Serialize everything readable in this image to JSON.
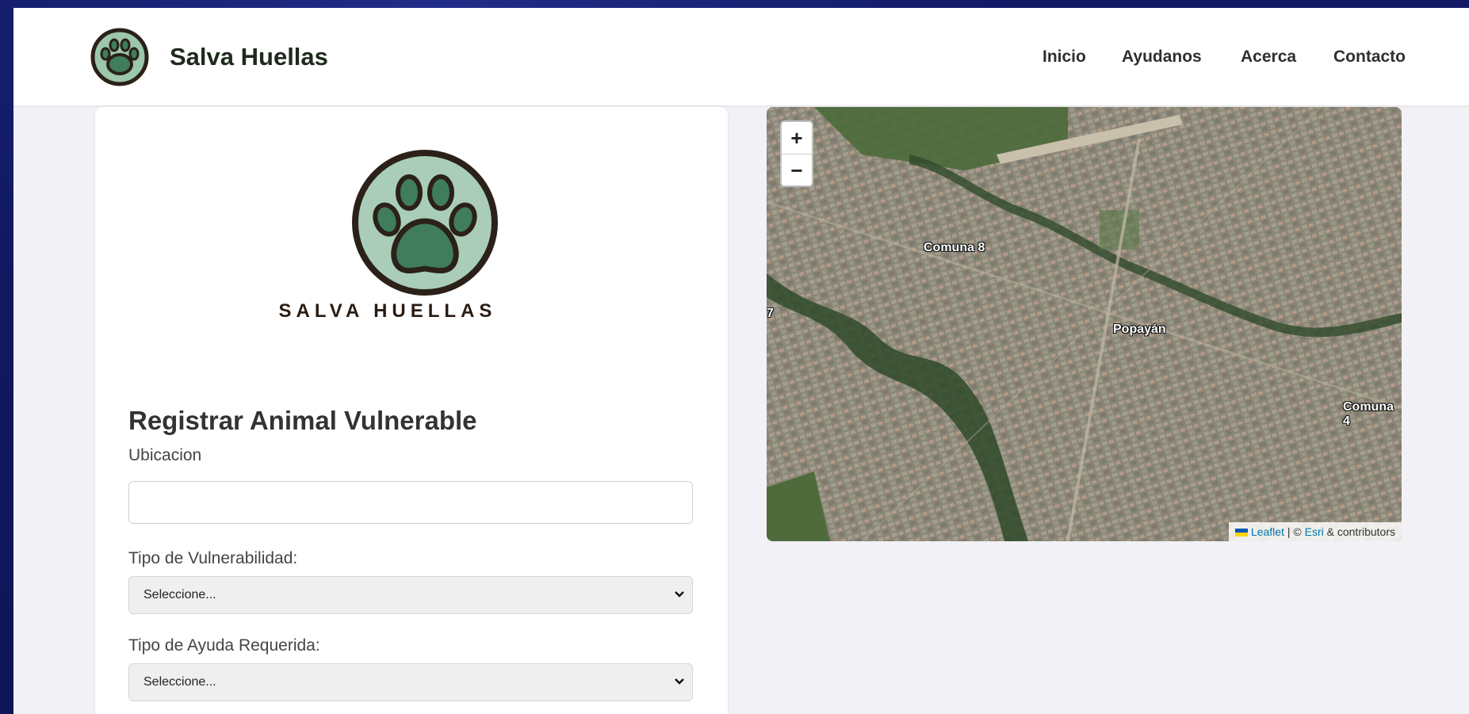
{
  "navbar": {
    "brand": "Salva Huellas",
    "links": [
      "Inicio",
      "Ayudanos",
      "Acerca",
      "Contacto"
    ]
  },
  "form": {
    "logo_text": "SALVA HUELLAS",
    "title": "Registrar Animal Vulnerable",
    "ubicacion_label": "Ubicacion",
    "ubicacion_value": "",
    "vulnerabilidad_label": "Tipo de Vulnerabilidad:",
    "vulnerabilidad_selected": "Seleccione...",
    "ayuda_label": "Tipo de Ayuda Requerida:",
    "ayuda_selected": "Seleccione..."
  },
  "map": {
    "labels": [
      "Comuna 8",
      "Popayán",
      "Comuna 4",
      "7"
    ],
    "zoom_in": "+",
    "zoom_out": "−",
    "attribution": {
      "leaflet": "Leaflet",
      "sep": " | © ",
      "esri": "Esri",
      "rest": " & contributors"
    }
  },
  "colors": {
    "brand_green": "#4b8a6a",
    "paw_dark": "#2b2118",
    "page_bg": "#f2f2f6",
    "outer_bg": "#10185e"
  }
}
